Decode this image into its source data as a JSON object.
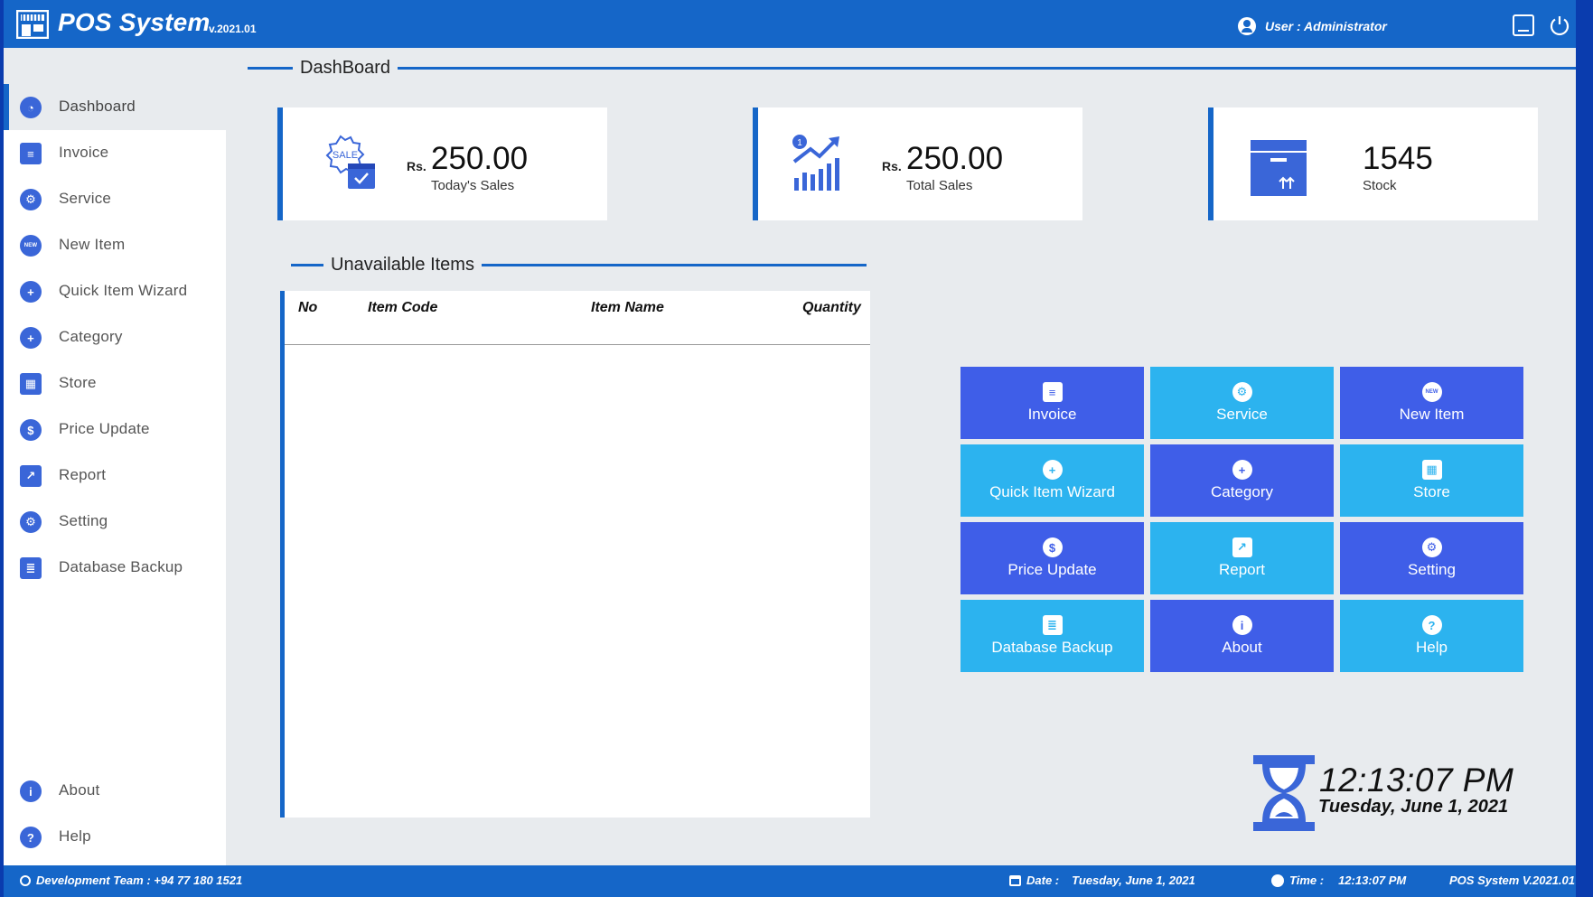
{
  "header": {
    "title": "POS System",
    "version": "v.2021.01",
    "user_label": "User : Administrator"
  },
  "sidebar": {
    "items": [
      {
        "label": "Dashboard",
        "icon": "dashboard-gauge-icon"
      },
      {
        "label": "Invoice",
        "icon": "invoice-icon"
      },
      {
        "label": "Service",
        "icon": "service-hand-gear-icon"
      },
      {
        "label": "New Item",
        "icon": "new-badge-icon"
      },
      {
        "label": "Quick Item Wizard",
        "icon": "plus-circle-icon"
      },
      {
        "label": "Category",
        "icon": "plus-circle-icon"
      },
      {
        "label": "Store",
        "icon": "store-icon"
      },
      {
        "label": "Price Update",
        "icon": "coins-icon"
      },
      {
        "label": "Report",
        "icon": "report-chart-icon"
      },
      {
        "label": "Setting",
        "icon": "gears-icon"
      },
      {
        "label": "Database Backup",
        "icon": "database-icon"
      }
    ],
    "bottom_items": [
      {
        "label": "About",
        "icon": "info-icon"
      },
      {
        "label": "Help",
        "icon": "question-icon"
      }
    ]
  },
  "dashboard": {
    "section_title": "DashBoard",
    "cards": [
      {
        "currency": "Rs.",
        "value": "250.00",
        "caption": "Today's Sales",
        "icon": "sale-badge-calendar-icon",
        "sale_text": "SALE"
      },
      {
        "currency": "Rs.",
        "value": "250.00",
        "caption": "Total Sales",
        "icon": "growth-chart-icon",
        "badge": "1"
      },
      {
        "value": "1545",
        "caption": "Stock",
        "icon": "stock-box-icon"
      }
    ]
  },
  "unavailable": {
    "section_title": "Unavailable Items",
    "columns": [
      "No",
      "Item Code",
      "Item Name",
      "Quantity"
    ],
    "rows": []
  },
  "tiles": [
    {
      "label": "Invoice",
      "icon": "invoice-icon",
      "style": "dark"
    },
    {
      "label": "Service",
      "icon": "service-hand-gear-icon",
      "style": "light"
    },
    {
      "label": "New Item",
      "icon": "new-badge-icon",
      "style": "dark"
    },
    {
      "label": "Quick Item Wizard",
      "icon": "plus-circle-icon",
      "style": "light"
    },
    {
      "label": "Category",
      "icon": "plus-circle-icon",
      "style": "dark"
    },
    {
      "label": "Store",
      "icon": "store-icon",
      "style": "light"
    },
    {
      "label": "Price Update",
      "icon": "coins-icon",
      "style": "dark"
    },
    {
      "label": "Report",
      "icon": "report-chart-icon",
      "style": "light"
    },
    {
      "label": "Setting",
      "icon": "gears-icon",
      "style": "dark"
    },
    {
      "label": "Database Backup",
      "icon": "database-icon",
      "style": "light"
    },
    {
      "label": "About",
      "icon": "info-icon",
      "style": "dark"
    },
    {
      "label": "Help",
      "icon": "question-icon",
      "style": "light"
    }
  ],
  "clock": {
    "time": "12:13:07 PM",
    "date": "Tuesday, June 1, 2021"
  },
  "footer": {
    "dev_team": "Development Team : +94 77 180 1521",
    "date_label": "Date :",
    "date_value": "Tuesday, June 1, 2021",
    "time_label": "Time :",
    "time_value": "12:13:07 PM",
    "version": "POS System V.2021.01"
  },
  "colors": {
    "primary": "#1566c8",
    "tile_dark": "#3f5ee8",
    "tile_light": "#2cb3ef",
    "background": "#e8ebee"
  }
}
